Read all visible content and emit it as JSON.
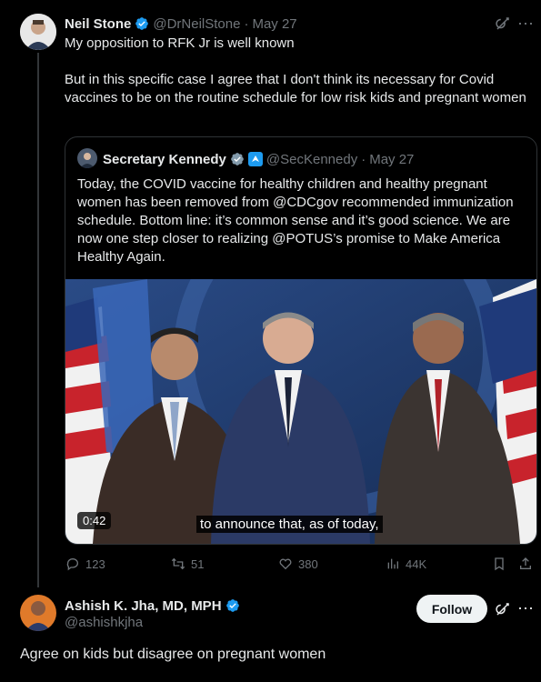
{
  "tweet1": {
    "name": "Neil Stone",
    "handle": "@DrNeilStone",
    "dot": "·",
    "date": "May 27",
    "line1": "My opposition to RFK Jr is well known",
    "line2": "But in this specific case I agree that I don't think its necessary for Covid vaccines to be on the routine schedule for low risk kids and pregnant women"
  },
  "quote": {
    "name": "Secretary Kennedy",
    "handle": "@SecKennedy",
    "dot": "·",
    "date": "May 27",
    "text": "Today, the COVID vaccine for healthy children and healthy pregnant women has been removed from @CDCgov recommended immunization schedule. Bottom line: it’s common sense and it’s good science. We are now one step closer to realizing @POTUS’s promise to Make America Healthy Again.",
    "video_duration": "0:42",
    "caption": "to announce that, as of today,"
  },
  "actions": {
    "replies": "123",
    "reposts": "51",
    "likes": "380",
    "views": "44K"
  },
  "reply": {
    "name": "Ashish K. Jha, MD, MPH",
    "handle": "@ashishkjha",
    "follow_label": "Follow",
    "text": "Agree on kids but disagree on pregnant women"
  },
  "colors": {
    "background": "#000000",
    "verified": "#1d9bf0",
    "muted": "#71767b",
    "border": "#2f3336"
  }
}
